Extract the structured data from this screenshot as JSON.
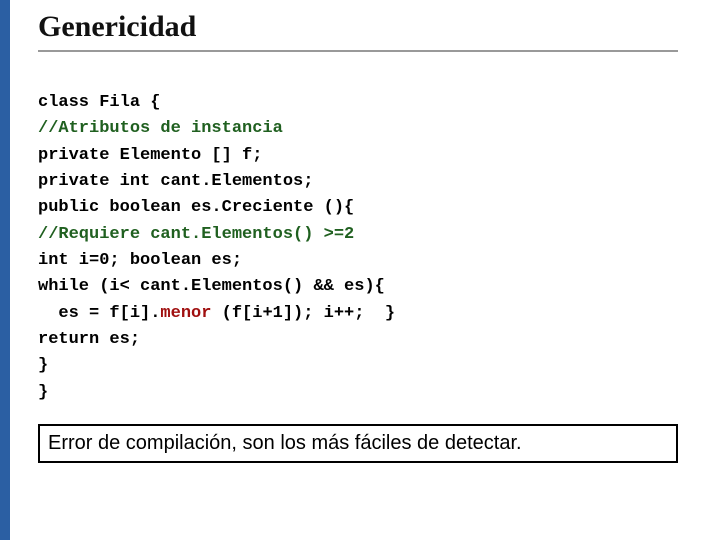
{
  "title": "Genericidad",
  "code": {
    "l1_a": "class Fila {",
    "l2_comment": "//Atributos de instancia",
    "l3": "private Elemento [] f;",
    "l4": "private int cant.Elementos;",
    "l5": "public boolean es.Creciente (){",
    "l6_comment": "//Requiere cant.Elementos() >=2",
    "l7": "int i=0; boolean es;",
    "l8": "while (i< cant.Elementos() && es){",
    "l9_a": "  es = f[i].",
    "l9_method": "menor",
    "l9_b": " (f[i+1]); i++;  }",
    "l10": "return es;",
    "l11": "}",
    "l12": "}"
  },
  "note": "Error de compilación, son los más fáciles de detectar."
}
